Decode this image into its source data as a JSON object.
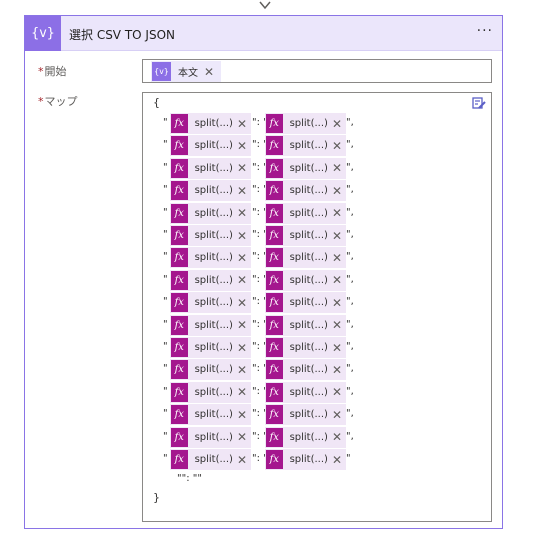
{
  "connector_arrow_icon": "down-arrow-icon",
  "action": {
    "icon": "{v}",
    "title": "選択 CSV TO JSON",
    "more_label": "···",
    "accent_color": "#8c6fe6"
  },
  "start": {
    "required_mark": "*",
    "label": "開始",
    "token": {
      "icon": "{v}",
      "label": "本文",
      "remove": "✕"
    }
  },
  "map": {
    "required_mark": "*",
    "label": "マップ",
    "open_brace": "{",
    "close_brace": "}",
    "rows": [
      {
        "open_quote": "\"",
        "key": "split(...)",
        "sep": "\": \"",
        "value": "split(...)",
        "end": "\","
      },
      {
        "open_quote": "\"",
        "key": "split(...)",
        "sep": "\": \"",
        "value": "split(...)",
        "end": "\","
      },
      {
        "open_quote": "\"",
        "key": "split(...)",
        "sep": "\": \"",
        "value": "split(...)",
        "end": "\","
      },
      {
        "open_quote": "\"",
        "key": "split(...)",
        "sep": "\": \"",
        "value": "split(...)",
        "end": "\","
      },
      {
        "open_quote": "\"",
        "key": "split(...)",
        "sep": "\": \"",
        "value": "split(...)",
        "end": "\","
      },
      {
        "open_quote": "\"",
        "key": "split(...)",
        "sep": "\": \"",
        "value": "split(...)",
        "end": "\","
      },
      {
        "open_quote": "\"",
        "key": "split(...)",
        "sep": "\": \"",
        "value": "split(...)",
        "end": "\","
      },
      {
        "open_quote": "\"",
        "key": "split(...)",
        "sep": "\": \"",
        "value": "split(...)",
        "end": "\","
      },
      {
        "open_quote": "\"",
        "key": "split(...)",
        "sep": "\": \"",
        "value": "split(...)",
        "end": "\","
      },
      {
        "open_quote": "\"",
        "key": "split(...)",
        "sep": "\": \"",
        "value": "split(...)",
        "end": "\","
      },
      {
        "open_quote": "\"",
        "key": "split(...)",
        "sep": "\": \"",
        "value": "split(...)",
        "end": "\","
      },
      {
        "open_quote": "\"",
        "key": "split(...)",
        "sep": "\": \"",
        "value": "split(...)",
        "end": "\","
      },
      {
        "open_quote": "\"",
        "key": "split(...)",
        "sep": "\": \"",
        "value": "split(...)",
        "end": "\","
      },
      {
        "open_quote": "\"",
        "key": "split(...)",
        "sep": "\": \"",
        "value": "split(...)",
        "end": "\","
      },
      {
        "open_quote": "\"",
        "key": "split(...)",
        "sep": "\": \"",
        "value": "split(...)",
        "end": "\","
      },
      {
        "open_quote": "\"",
        "key": "split(...)",
        "sep": "\": \"",
        "value": "split(...)",
        "end": "\""
      }
    ],
    "token_icon": "fx",
    "token_remove": "✕",
    "last_line": "\"\": \"\""
  }
}
